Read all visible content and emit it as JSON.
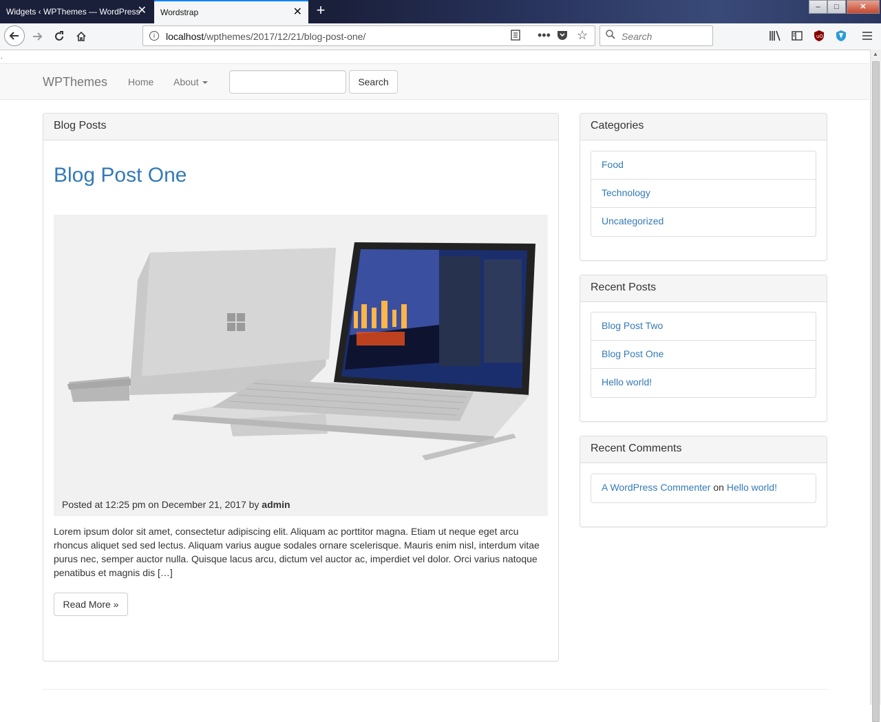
{
  "browser": {
    "tabs": [
      {
        "title": "Widgets ‹ WPThemes — WordPress",
        "active": false
      },
      {
        "title": "Wordstrap",
        "active": true
      }
    ],
    "url_host": "localhost",
    "url_path": "/wpthemes/2017/12/21/blog-post-one/",
    "search_placeholder": "Search",
    "window_controls": {
      "minimize": "–",
      "maximize": "□",
      "close": "✕"
    },
    "icons": [
      "back-icon",
      "forward-icon",
      "reload-icon",
      "home-icon",
      "info-icon",
      "reader-icon",
      "more-icon",
      "pocket-icon",
      "bookmark-star-icon",
      "search-icon",
      "library-icon",
      "sidebar-icon",
      "ublock-icon",
      "shield-icon",
      "menu-icon"
    ]
  },
  "site": {
    "brand": "WPThemes",
    "nav": [
      {
        "label": "Home"
      },
      {
        "label": "About"
      }
    ],
    "search_button": "Search",
    "search_value": ""
  },
  "main": {
    "panel_heading": "Blog Posts",
    "post": {
      "title": "Blog Post One",
      "meta_prefix": "Posted at 12:25 pm on December 21, 2017 by ",
      "author": "admin",
      "excerpt": "Lorem ipsum dolor sit amet, consectetur adipiscing elit. Aliquam ac porttitor magna. Etiam ut neque eget arcu rhoncus aliquet sed sed lectus. Aliquam varius augue sodales ornare scelerisque. Mauris enim nisl, interdum vitae purus nec, semper auctor nulla. Quisque lacus arcu, dictum vel auctor ac, imperdiet vel dolor. Orci varius natoque penatibus et magnis dis […]",
      "read_more": "Read More »"
    }
  },
  "sidebar": {
    "categories": {
      "heading": "Categories",
      "items": [
        "Food",
        "Technology",
        "Uncategorized"
      ]
    },
    "recent_posts": {
      "heading": "Recent Posts",
      "items": [
        "Blog Post Two",
        "Blog Post One",
        "Hello world!"
      ]
    },
    "recent_comments": {
      "heading": "Recent Comments",
      "items": [
        {
          "author": "A WordPress Commenter",
          "on": "on",
          "post": "Hello world!"
        }
      ]
    }
  },
  "colors": {
    "link": "#337ab7",
    "tab_active_accent": "#0a84ff",
    "navbar_bg": "#f8f8f8"
  }
}
